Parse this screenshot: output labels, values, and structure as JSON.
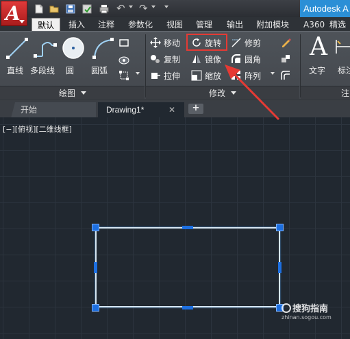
{
  "app": {
    "title": "Autodesk A",
    "logo_letter": "A"
  },
  "ribbon_tabs": [
    "默认",
    "插入",
    "注释",
    "参数化",
    "视图",
    "管理",
    "输出",
    "附加模块",
    "A360",
    "精选"
  ],
  "draw_panel": {
    "footer": "绘图",
    "tools": [
      "直线",
      "多段线",
      "圆",
      "圆弧"
    ]
  },
  "modify_panel": {
    "footer": "修改",
    "tools": [
      "移动",
      "旋转",
      "修剪",
      "复制",
      "镜像",
      "圆角",
      "拉伸",
      "缩放",
      "阵列"
    ],
    "highlighted_tool": "旋转"
  },
  "annotation_panel": {
    "footer": "注",
    "tools": [
      "文字",
      "标注"
    ],
    "text_icon_letter": "A"
  },
  "document_tabs": {
    "start": "开始",
    "current": "Drawing1*",
    "close_glyph": "✕",
    "new_glyph": "+"
  },
  "viewport": {
    "label": "[−][俯视][二维线框]"
  },
  "watermark": {
    "name": "搜狗指南",
    "url": "zhinan.sogou.com"
  },
  "colors": {
    "accent_blue": "#2b8fd6",
    "highlight_red": "#e53a34",
    "grip_blue": "#1d6fe0",
    "canvas_bg": "#212830"
  }
}
